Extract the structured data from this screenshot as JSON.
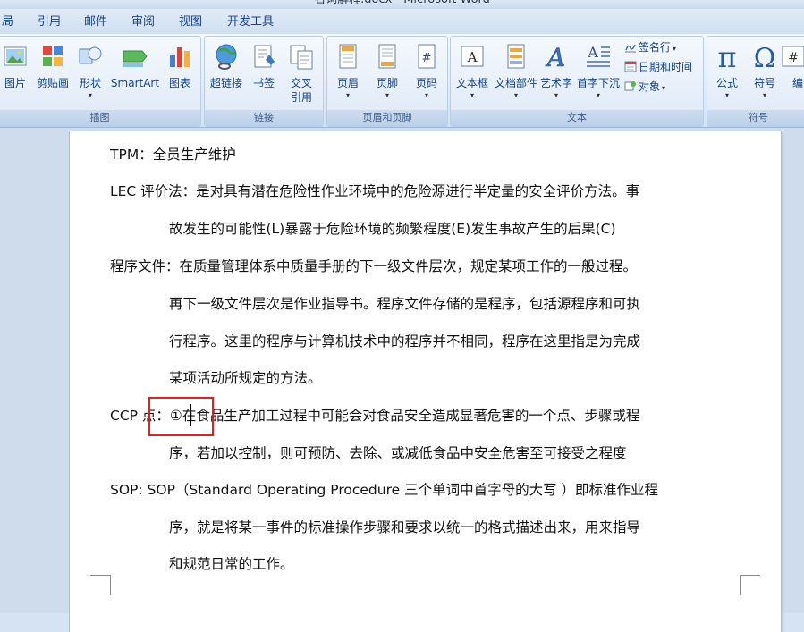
{
  "window": {
    "title": "名词解释.docx - Microsoft Word"
  },
  "tabs": [
    {
      "label": "局"
    },
    {
      "label": "引用"
    },
    {
      "label": "邮件"
    },
    {
      "label": "审阅"
    },
    {
      "label": "视图"
    },
    {
      "label": "开发工具"
    }
  ],
  "ribbon": {
    "groups": {
      "illustrations": "插图",
      "links": "链接",
      "header_footer": "页眉和页脚",
      "text": "文本",
      "symbols": "符号"
    },
    "buttons": {
      "picture": "图片",
      "clipart": "剪贴画",
      "shapes": "形状",
      "smartart": "SmartArt",
      "chart": "图表",
      "hyperlink": "超链接",
      "bookmark": "书签",
      "crossref_1": "交叉",
      "crossref_2": "引用",
      "header": "页眉",
      "footer": "页脚",
      "pagenum": "页码",
      "textbox": "文本框",
      "quickparts": "文档部件",
      "wordart": "艺术字",
      "dropcap": "首字下沉",
      "signature": "签名行",
      "datetime": "日期和时间",
      "object": "对象",
      "equation": "公式",
      "symbol": "符号",
      "number": "编"
    },
    "dropdown_arrow": "▾",
    "icons": {
      "equation_glyph": "π",
      "symbol_glyph": "Ω",
      "wordart_glyph": "A",
      "pagenum_glyph": "#"
    }
  },
  "document": {
    "lines": [
      "TPM：全员生产维护",
      "LEC 评价法：是对具有潜在危险性作业环境中的危险源进行半定量的安全评价方法。事",
      "故发生的可能性(L)暴露于危险环境的频繁程度(E)发生事故产生的后果(C)",
      "程序文件：在质量管理体系中质量手册的下一级文件层次，规定某项工作的一般过程。",
      "再下一级文件层次是作业指导书。程序文件存储的是程序，包括源程序和可执",
      "行程序。这里的程序与计算机技术中的程序并不相同，程序在这里指是为完成",
      "某项活动所规定的方法。",
      "CCP 点：①在食品生产加工过程中可能会对食品安全造成显著危害的一个点、步骤或程",
      "序，若加以控制，则可预防、去除、或减低食品中安全危害至可接受之程度",
      "SOP: SOP（Standard Operating Procedure 三个单词中首字母的大写 ）即标准作业程",
      "序，就是将某一事件的标准操作步骤和要求以统一的格式描述出来，用来指导",
      "和规范日常的工作。"
    ]
  }
}
